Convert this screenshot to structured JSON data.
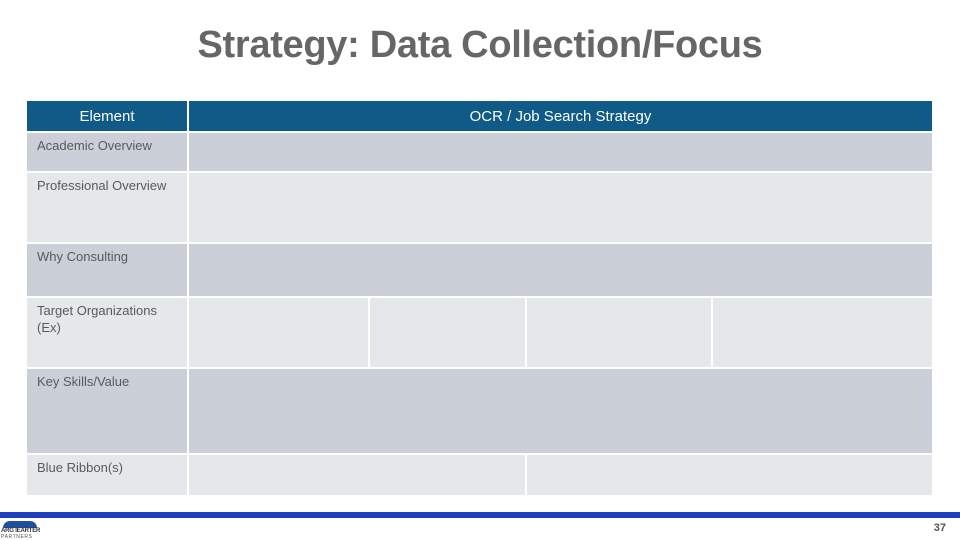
{
  "slide": {
    "title": "Strategy: Data Collection/Focus",
    "page_number": "37"
  },
  "table": {
    "headers": {
      "element": "Element",
      "strategy": "OCR / Job Search Strategy"
    },
    "rows": [
      {
        "label": "Academic Overview"
      },
      {
        "label": "Professional Overview"
      },
      {
        "label": "Why Consulting"
      },
      {
        "label": "Target Organizations (Ex)"
      },
      {
        "label": "Key Skills/Value"
      },
      {
        "label": "Blue Ribbon(s)"
      }
    ]
  },
  "footer": {
    "logo_line1": "ARG IEARTER",
    "logo_line2": "PARTNERS",
    "accent_color": "#1f3fbf"
  }
}
